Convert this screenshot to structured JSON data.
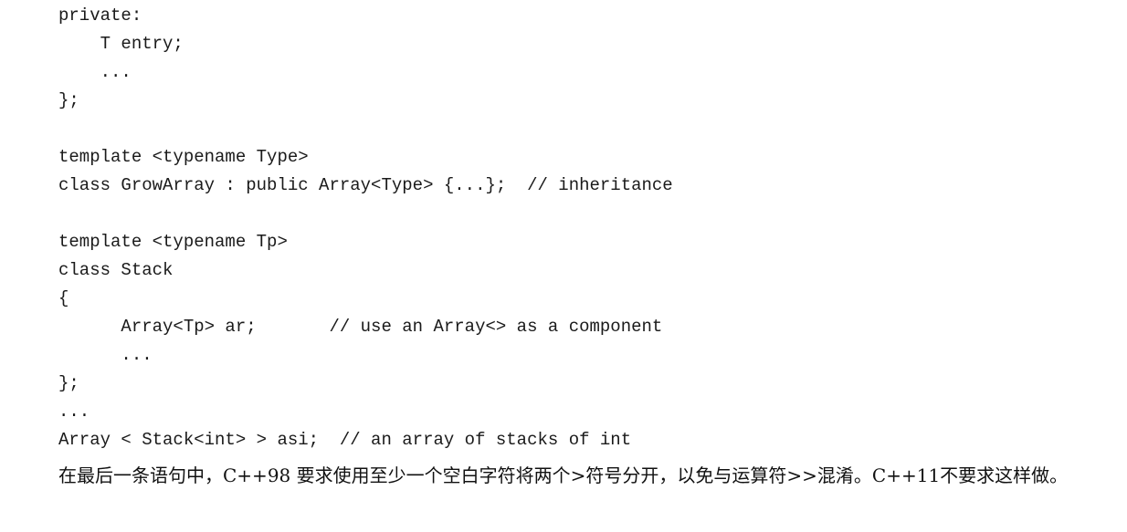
{
  "code": {
    "lines": [
      "private:",
      "    T entry;",
      "    ...",
      "};",
      "",
      "template <typename Type>",
      "class GrowArray : public Array<Type> {...};  // inheritance",
      "",
      "template <typename Tp>",
      "class Stack",
      "{",
      "      Array<Tp> ar;       // use an Array<> as a component",
      "      ...",
      "};",
      "...",
      "Array < Stack<int> > asi;  // an array of stacks of int"
    ]
  },
  "prose": {
    "paragraph": "在最后一条语句中，C++98 要求使用至少一个空白字符将两个>符号分开，以免与运算符>>混淆。C++11不要求这样做。"
  }
}
